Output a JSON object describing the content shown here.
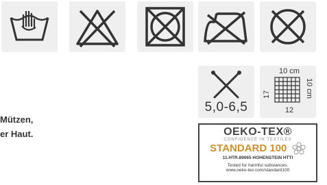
{
  "care_icons": [
    "hand-wash-icon",
    "do-not-bleach-icon",
    "do-not-tumble-dry-icon",
    "iron-low-heat-icon",
    "do-not-dry-clean-icon"
  ],
  "needle": {
    "icon": "knitting-needles-icon",
    "size": "5,0-6,5"
  },
  "gauge": {
    "icon": "gauge-grid-icon",
    "top": "10 cm",
    "right": "10 cm",
    "left": "17",
    "bottom": "12"
  },
  "description": {
    "line1": "Mützen,",
    "line2": "er Haut."
  },
  "oeko": {
    "title": "OEKO-TEX®",
    "confidence": "CONFIDENCE IN TEXTILES",
    "standard": "STANDARD 100",
    "id": "11.HTR.89065 HOHENSTEIN HTTI",
    "tested": "Tested for harmful substances.",
    "url": "www.oeko-tex.com/standard100",
    "accent_color": "#c8912a"
  }
}
